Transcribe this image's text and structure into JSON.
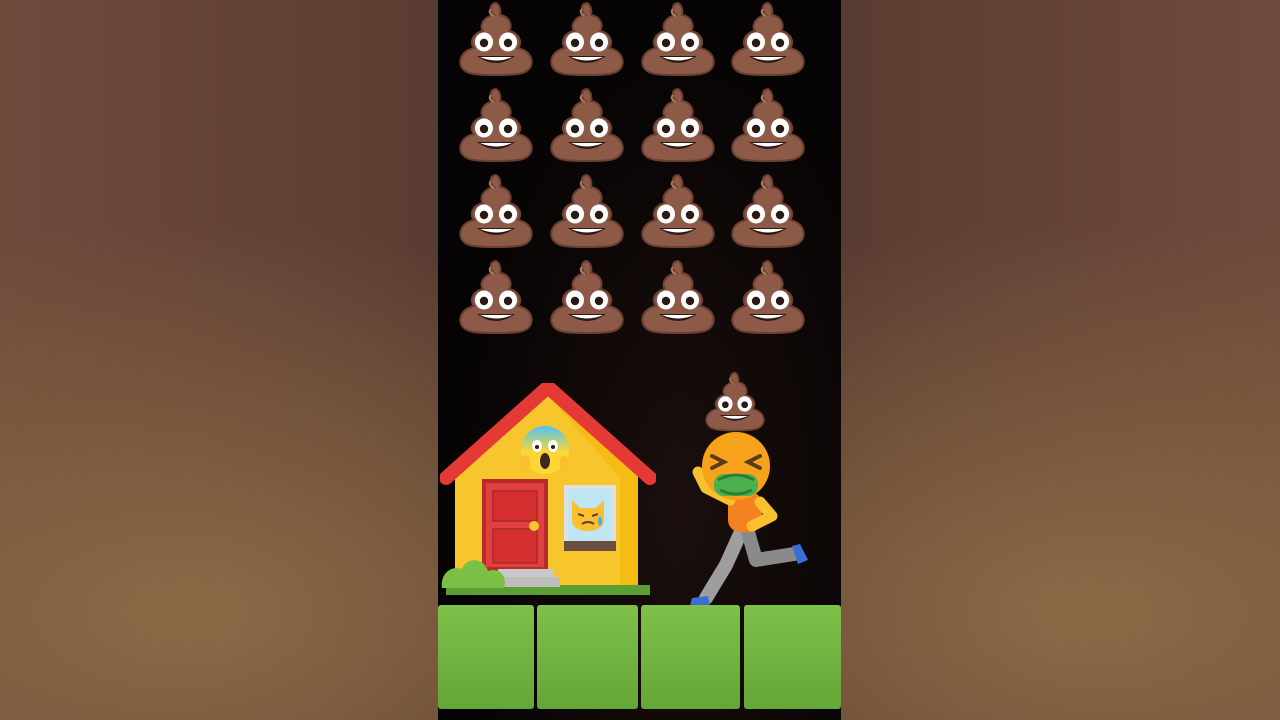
{
  "scene": {
    "background_color": "#050303",
    "blur_side_color": "#5c3e33",
    "poop_grid": {
      "rows": 4,
      "cols": 4
    },
    "falling_poop": 1,
    "ground_tiles": 4,
    "emoji_names": [
      "pile-of-poo",
      "house",
      "face-screaming-in-fear",
      "crying-cat",
      "vomiting-face",
      "person-running"
    ],
    "colors": {
      "poop_brown": "#8d5a48",
      "house_wall": "#f7c52c",
      "roof_red": "#e53935",
      "door_red": "#d32f2f",
      "grass_green": "#6fb33d",
      "face_orange": "#f7a21b"
    }
  }
}
